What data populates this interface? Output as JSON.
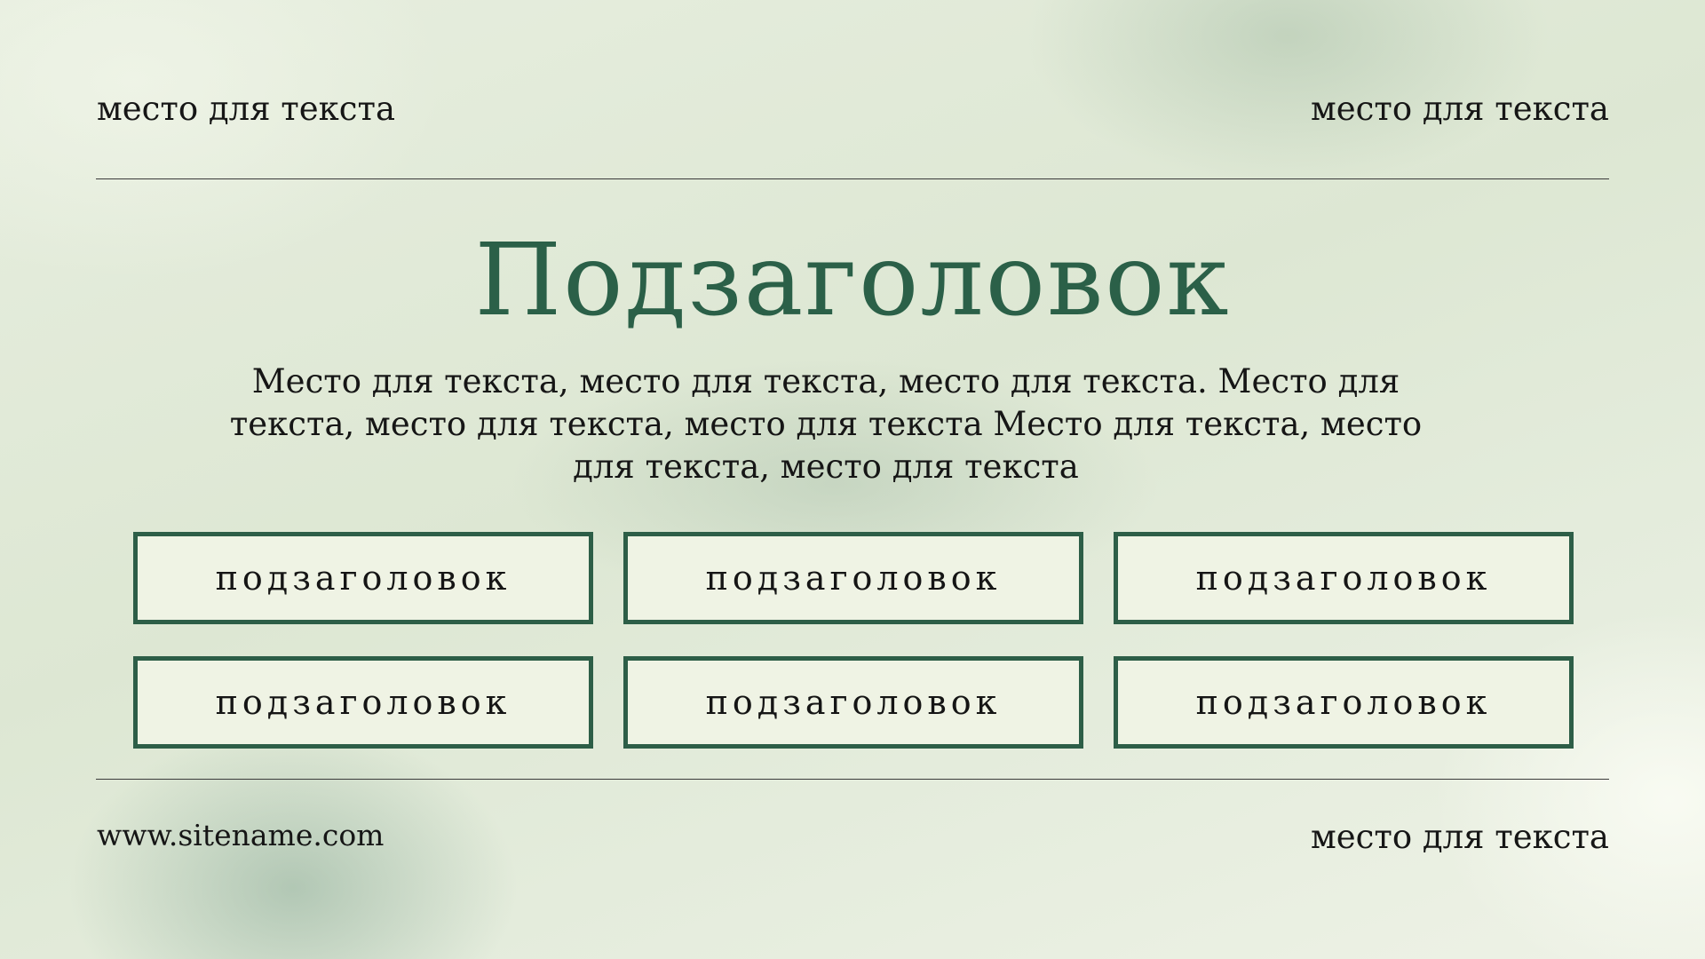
{
  "header": {
    "left_text": "место для текста",
    "right_text": "место для текста"
  },
  "main": {
    "title": "Подзаголовок",
    "body": "Место для текста, место для текста, место для текста. Место для текста, место для текста, место для текста Место для текста, место для текста, место для текста",
    "boxes": [
      {
        "label": "подзаголовок"
      },
      {
        "label": "подзаголовок"
      },
      {
        "label": "подзаголовок"
      },
      {
        "label": "подзаголовок"
      },
      {
        "label": "подзаголовок"
      },
      {
        "label": "подзаголовок"
      }
    ]
  },
  "footer": {
    "website": "www.sitename.com",
    "right_text": "место для текста"
  },
  "colors": {
    "accent": "#2b6048",
    "box_border": "#2d5e47",
    "box_fill": "#eff3e4",
    "text": "#161616"
  }
}
